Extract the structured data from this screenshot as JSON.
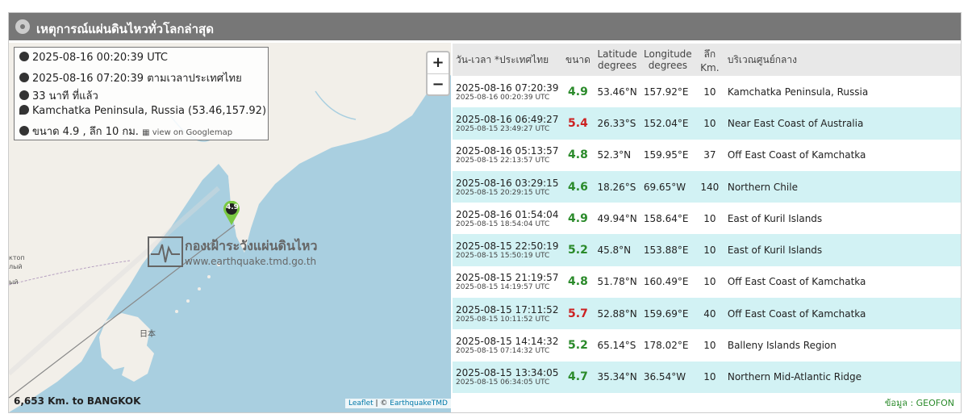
{
  "title": "เหตุการณ์แผ่นดินไหวทั่วโลกล่าสุด",
  "info": {
    "utc_time": "2025-08-16 00:20:39 UTC",
    "thai_time": "2025-08-16 07:20:39 ตามเวลาประเทศไทย",
    "ago": "33 นาที ที่แล้ว",
    "location": "Kamchatka Peninsula, Russia (53.46,157.92)",
    "magnitude_depth": "ขนาด 4.9 , ลึก 10 กม.",
    "googlemap_link": "view on Googlemap"
  },
  "map": {
    "zoom_in": "+",
    "zoom_out": "−",
    "marker_label": "4.9",
    "distance": "6,653 Km. to BANGKOK",
    "attribution_leaflet": "Leaflet",
    "attribution_sep": " | © ",
    "attribution_source": "EarthquakeTMD",
    "watermark_name": "กองเฝ้าระวังแผ่นดินไหว",
    "watermark_url": "www.earthquake.tmd.go.th",
    "label_japan": "日本",
    "side_labels": [
      "ктоп",
      "лый",
      "ый"
    ]
  },
  "colors": {
    "mag_green": "#2a8a2a",
    "mag_red": "#cc2222",
    "row_alt": "#d2f2f4",
    "header_bg": "#e8e8e8",
    "titlebar_bg": "#777777"
  },
  "table": {
    "headers": {
      "datetime": "วัน-เวลา *ประเทศไทย",
      "magnitude": "ขนาด",
      "lat": "Latitude degrees",
      "lon": "Longitude degrees",
      "depth": "ลึก Km.",
      "region": "บริเวณศูนย์กลาง"
    },
    "rows": [
      {
        "dt": "2025-08-16 07:20:39",
        "utc": "2025-08-16 00:20:39 UTC",
        "mag": "4.9",
        "lat": "53.46°N",
        "lon": "157.92°E",
        "depth": "10",
        "region": "Kamchatka Peninsula, Russia",
        "mag_color": "#2a8a2a"
      },
      {
        "dt": "2025-08-16 06:49:27",
        "utc": "2025-08-15 23:49:27 UTC",
        "mag": "5.4",
        "lat": "26.33°S",
        "lon": "152.04°E",
        "depth": "10",
        "region": "Near East Coast of Australia",
        "mag_color": "#cc2222"
      },
      {
        "dt": "2025-08-16 05:13:57",
        "utc": "2025-08-15 22:13:57 UTC",
        "mag": "4.8",
        "lat": "52.3°N",
        "lon": "159.95°E",
        "depth": "37",
        "region": "Off East Coast of Kamchatka",
        "mag_color": "#2a8a2a"
      },
      {
        "dt": "2025-08-16 03:29:15",
        "utc": "2025-08-15 20:29:15 UTC",
        "mag": "4.6",
        "lat": "18.26°S",
        "lon": "69.65°W",
        "depth": "140",
        "region": "Northern Chile",
        "mag_color": "#2a8a2a"
      },
      {
        "dt": "2025-08-16 01:54:04",
        "utc": "2025-08-15 18:54:04 UTC",
        "mag": "4.9",
        "lat": "49.94°N",
        "lon": "158.64°E",
        "depth": "10",
        "region": "East of Kuril Islands",
        "mag_color": "#2a8a2a"
      },
      {
        "dt": "2025-08-15 22:50:19",
        "utc": "2025-08-15 15:50:19 UTC",
        "mag": "5.2",
        "lat": "45.8°N",
        "lon": "153.88°E",
        "depth": "10",
        "region": "East of Kuril Islands",
        "mag_color": "#2a8a2a"
      },
      {
        "dt": "2025-08-15 21:19:57",
        "utc": "2025-08-15 14:19:57 UTC",
        "mag": "4.8",
        "lat": "51.78°N",
        "lon": "160.49°E",
        "depth": "10",
        "region": "Off East Coast of Kamchatka",
        "mag_color": "#2a8a2a"
      },
      {
        "dt": "2025-08-15 17:11:52",
        "utc": "2025-08-15 10:11:52 UTC",
        "mag": "5.7",
        "lat": "52.88°N",
        "lon": "159.69°E",
        "depth": "40",
        "region": "Off East Coast of Kamchatka",
        "mag_color": "#cc2222"
      },
      {
        "dt": "2025-08-15 14:14:32",
        "utc": "2025-08-15 07:14:32 UTC",
        "mag": "5.2",
        "lat": "65.14°S",
        "lon": "178.02°E",
        "depth": "10",
        "region": "Balleny Islands Region",
        "mag_color": "#2a8a2a"
      },
      {
        "dt": "2025-08-15 13:34:05",
        "utc": "2025-08-15 06:34:05 UTC",
        "mag": "4.7",
        "lat": "35.34°N",
        "lon": "36.54°W",
        "depth": "10",
        "region": "Northern Mid-Atlantic Ridge",
        "mag_color": "#2a8a2a"
      }
    ]
  },
  "source": "ข้อมูล : GEOFON"
}
